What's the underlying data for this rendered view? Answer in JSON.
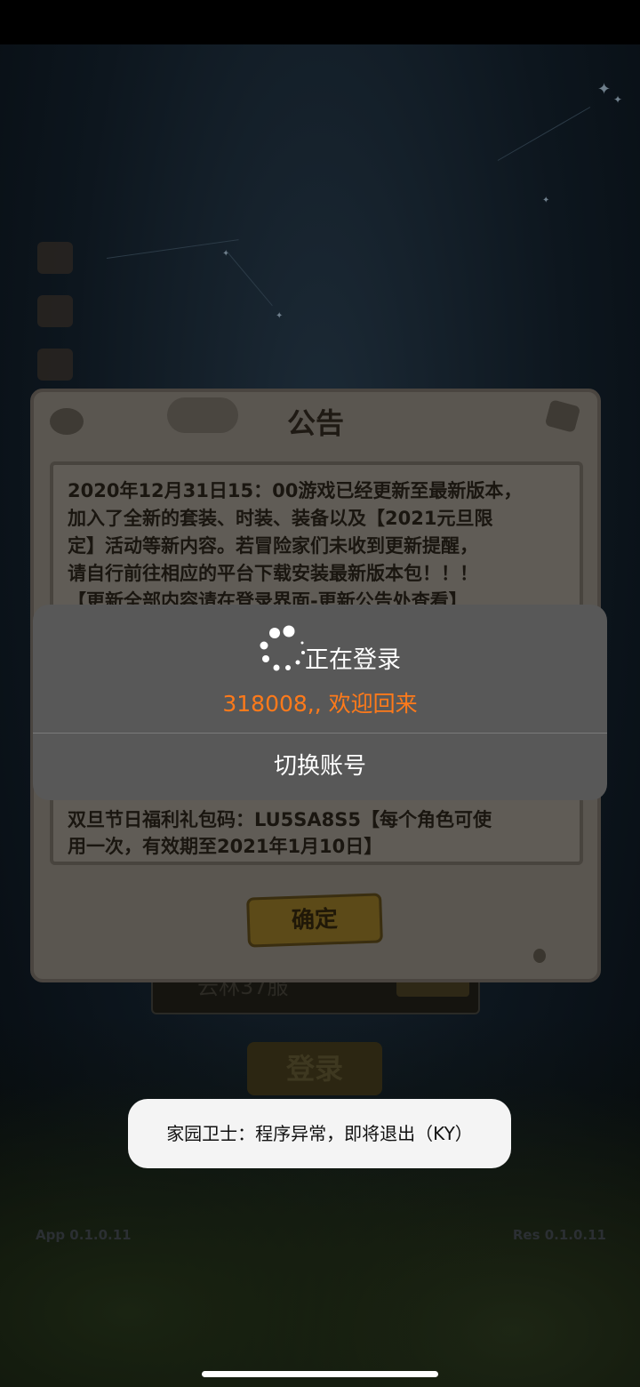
{
  "announcement": {
    "title": "公告",
    "body": "2020年12月31日15：00游戏已经更新至最新版本，\n加入了全新的套装、时装、装备以及【2021元旦限\n定】活动等新内容。若冒险家们未收到更新提醒，\n请自行前往相应的平台下载安装最新版本包！！！\n【更新全部内容请在登录界面-更新公告处查看】",
    "body_bottom": "双旦节日福利礼包码：LU5SA8S5【每个角色可使\n用一次，有效期至2021年1月10日】",
    "confirm_label": "确定"
  },
  "background": {
    "server_text": "云林37服",
    "login_label": "登录",
    "app_version": "App 0.1.0.11",
    "res_version": "Res 0.1.0.11"
  },
  "login_dialog": {
    "status": "正在登录",
    "welcome": "318008,, 欢迎回来",
    "switch_account": "切换账号",
    "welcome_color": "#ff7a1a"
  },
  "toast": {
    "message": "家园卫士：程序异常，即将退出（KY）"
  }
}
